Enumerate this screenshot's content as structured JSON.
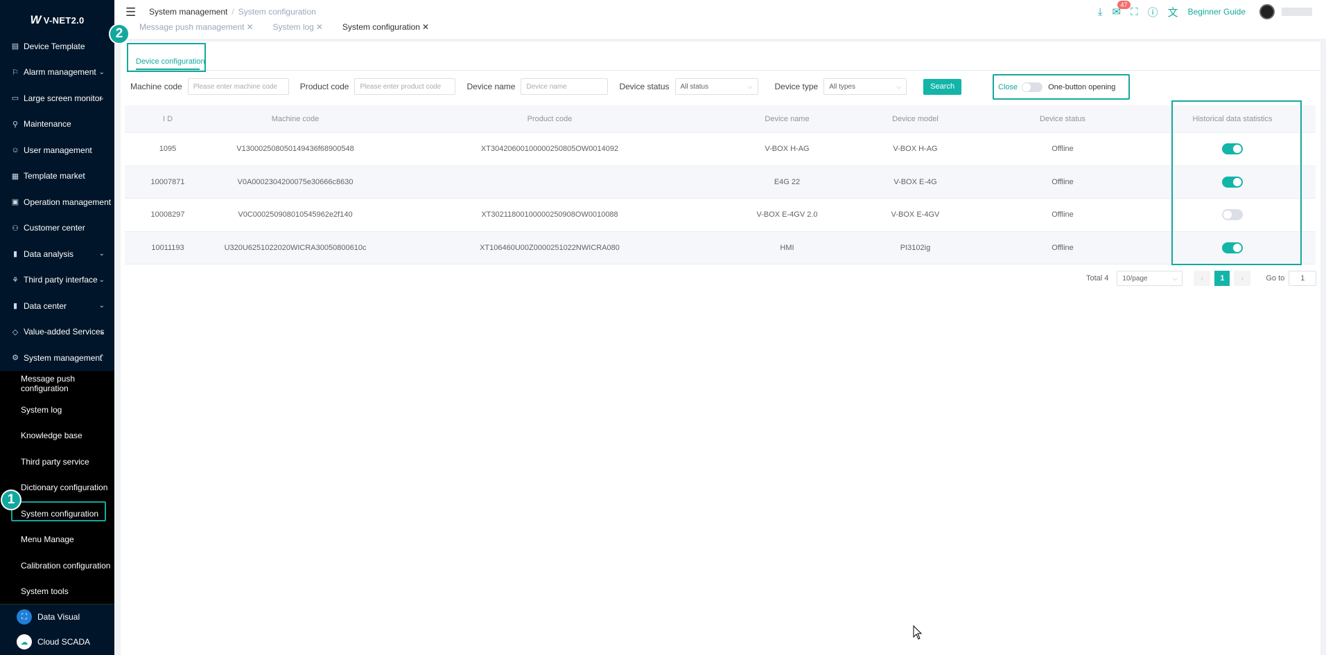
{
  "sidebar": {
    "logo": "V-NET2.0",
    "logo_mark": "W",
    "items": [
      {
        "label": "Device Template",
        "icon": "template-icon",
        "glyph": "▤",
        "chevron": false
      },
      {
        "label": "Alarm management",
        "icon": "alarm-icon",
        "glyph": "⚐",
        "chevron": true
      },
      {
        "label": "Large screen monitor",
        "icon": "monitor-icon",
        "glyph": "▭",
        "chevron": true
      },
      {
        "label": "Maintenance",
        "icon": "maintenance-icon",
        "glyph": "⚲",
        "chevron": false
      },
      {
        "label": "User management",
        "icon": "user-icon",
        "glyph": "☺",
        "chevron": false
      },
      {
        "label": "Template market",
        "icon": "market-icon",
        "glyph": "▦",
        "chevron": false
      },
      {
        "label": "Operation management",
        "icon": "operation-icon",
        "glyph": "▣",
        "chevron": false
      },
      {
        "label": "Customer center",
        "icon": "customer-icon",
        "glyph": "⚇",
        "chevron": false
      },
      {
        "label": "Data analysis",
        "icon": "chart-icon",
        "glyph": "▮",
        "chevron": true
      },
      {
        "label": "Third party interface",
        "icon": "interface-icon",
        "glyph": "⚘",
        "chevron": true
      },
      {
        "label": "Data center",
        "icon": "data-center-icon",
        "glyph": "▮",
        "chevron": true
      },
      {
        "label": "Value-added Services",
        "icon": "diamond-icon",
        "glyph": "◇",
        "chevron": true
      },
      {
        "label": "System management",
        "icon": "system-icon",
        "glyph": "⚙",
        "chevron": true,
        "expanded": true
      }
    ],
    "submenu": [
      {
        "label": "Message push configuration"
      },
      {
        "label": "System log"
      },
      {
        "label": "Knowledge base"
      },
      {
        "label": "Third party service"
      },
      {
        "label": "Dictionary configuration"
      },
      {
        "label": "System configuration",
        "active": true
      },
      {
        "label": "Menu Manage"
      },
      {
        "label": "Calibration configuration"
      },
      {
        "label": "System tools"
      }
    ],
    "bottom": [
      {
        "label": "Data Visual",
        "icon": "data-visual-icon",
        "glyph": "⛶",
        "color": "#1f7fd6"
      },
      {
        "label": "Cloud SCADA",
        "icon": "cloud-icon",
        "glyph": "☁",
        "color": "#ffffff"
      }
    ]
  },
  "annotations": {
    "step1": "1",
    "step2": "2"
  },
  "header": {
    "breadcrumb": [
      "System management",
      "System configuration"
    ],
    "tabs": [
      {
        "label": "Message push management",
        "active": false
      },
      {
        "label": "System log",
        "active": false
      },
      {
        "label": "System configuration",
        "active": true
      }
    ],
    "notification_count": "47",
    "guide": "Beginner Guide"
  },
  "content": {
    "subtab": "Device configuration",
    "filters": {
      "machine_code_label": "Machine code",
      "machine_code_placeholder": "Please enter machine code",
      "product_code_label": "Product code",
      "product_code_placeholder": "Please enter product code",
      "device_name_label": "Device name",
      "device_name_placeholder": "Device name",
      "device_status_label": "Device status",
      "device_status_value": "All status",
      "device_type_label": "Device type",
      "device_type_value": "All types",
      "search": "Search"
    },
    "one_button": {
      "close": "Close",
      "open": "One-button opening",
      "enabled": false
    },
    "table": {
      "columns": [
        "I D",
        "Machine code",
        "Product code",
        "Device name",
        "Device model",
        "Device status",
        "Historical data statistics"
      ],
      "rows": [
        {
          "id": "1095",
          "machine_code": "V130002508050149436f68900548",
          "product_code": "XT30420600100000250805OW0014092",
          "device_name": "V-BOX H-AG",
          "device_model": "V-BOX H-AG",
          "status": "Offline",
          "historical": true
        },
        {
          "id": "10007871",
          "machine_code": "V0A0002304200075e30666c8630",
          "product_code": "",
          "device_name": "E4G 22",
          "device_model": "V-BOX E-4G",
          "status": "Offline",
          "historical": true
        },
        {
          "id": "10008297",
          "machine_code": "V0C000250908010545962e2f140",
          "product_code": "XT30211800100000250908OW0010088",
          "device_name": "V-BOX E-4GV 2.0",
          "device_model": "V-BOX E-4GV",
          "status": "Offline",
          "historical": false
        },
        {
          "id": "10011193",
          "machine_code": "U320U6251022020WICRA30050800610c",
          "product_code": "XT106460U00Z0000251022NWICRA080",
          "device_name": "HMI",
          "device_model": "PI3102ig",
          "status": "Offline",
          "historical": true
        }
      ]
    },
    "pagination": {
      "total": "Total 4",
      "page_size": "10/page",
      "current": "1",
      "goto_label": "Go to",
      "goto_value": "1"
    }
  },
  "colors": {
    "accent": "#13a89e",
    "sidebar_bg": "#001529",
    "danger": "#f56c6c"
  }
}
